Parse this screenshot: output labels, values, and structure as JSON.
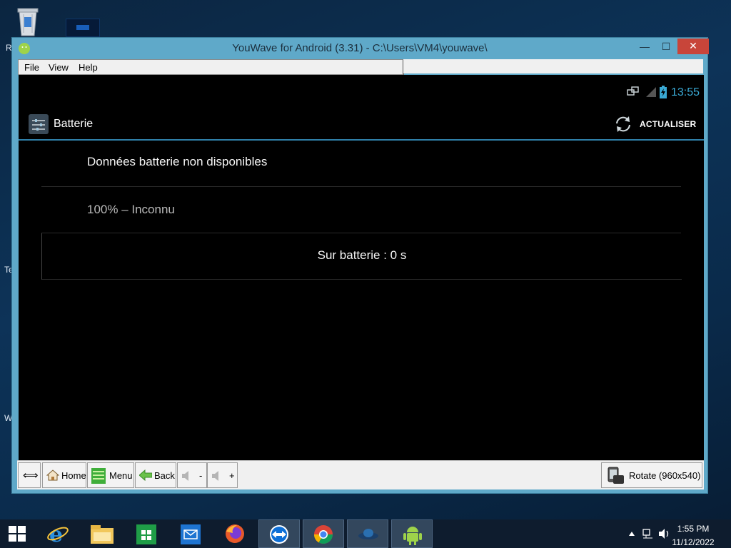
{
  "desktop": {
    "side_letters": [
      "R",
      "Te",
      "W"
    ]
  },
  "window": {
    "title": "YouWave for Android (3.31) - C:\\Users\\VM4\\youwave\\",
    "min_glyph": "—",
    "max_glyph": "☐",
    "close_glyph": "✕"
  },
  "menu": {
    "items": [
      {
        "label": "File"
      },
      {
        "label": "View"
      },
      {
        "label": "Help"
      }
    ]
  },
  "android": {
    "status_time": "13:55",
    "action_bar": {
      "title": "Batterie",
      "refresh_label": "ACTUALISER"
    },
    "rows": [
      {
        "text": "Données batterie non disponibles"
      },
      {
        "text": "100% – Inconnu"
      },
      {
        "text": "Sur batterie : 0 s"
      }
    ]
  },
  "toolbar": {
    "resize_glyph": "⟺",
    "home_label": "Home",
    "menu_label": "Menu",
    "back_label": "Back",
    "vol_down_label": "-",
    "vol_up_label": "+",
    "rotate_label": "Rotate (960x540)"
  },
  "taskbar": {
    "time": "1:55 PM",
    "date": "11/12/2022",
    "colors": {
      "accent": "#2f7fa8",
      "clock": "#3aa9d4"
    }
  }
}
